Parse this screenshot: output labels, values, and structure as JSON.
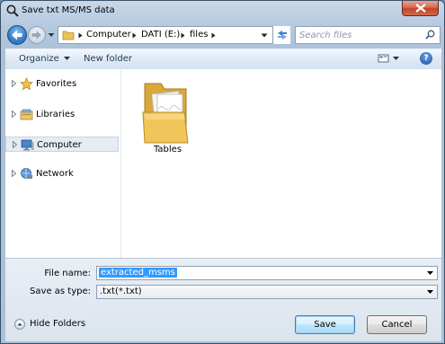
{
  "window": {
    "title": "Save txt MS/MS data",
    "title_icon": "magnifier-icon",
    "close_icon": "close-icon"
  },
  "navigation": {
    "breadcrumbs": [
      "Computer",
      "DATI (E:)",
      "files"
    ],
    "search_placeholder": "Search files"
  },
  "toolbar": {
    "organize_label": "Organize",
    "new_folder_label": "New folder",
    "view_icon": "view-options-icon",
    "help_label": "?"
  },
  "sidebar": {
    "items": [
      {
        "label": "Favorites",
        "icon": "star-icon",
        "selected": false
      },
      {
        "label": "Libraries",
        "icon": "library-icon",
        "selected": false
      },
      {
        "label": "Computer",
        "icon": "computer-icon",
        "selected": true
      },
      {
        "label": "Network",
        "icon": "network-icon",
        "selected": false
      }
    ]
  },
  "files": [
    {
      "name": "Tables",
      "icon": "folder-icon"
    }
  ],
  "form": {
    "file_name_label": "File name:",
    "file_name_value": "extracted_msms",
    "save_as_type_label": "Save as type:",
    "save_as_type_value": ".txt(*.txt)"
  },
  "buttons": {
    "hide_folders_label": "Hide Folders",
    "save_label": "Save",
    "cancel_label": "Cancel"
  },
  "colors": {
    "window_frame": "#b4c8de",
    "selection": "#3399ff",
    "close_button": "#c4432a"
  }
}
